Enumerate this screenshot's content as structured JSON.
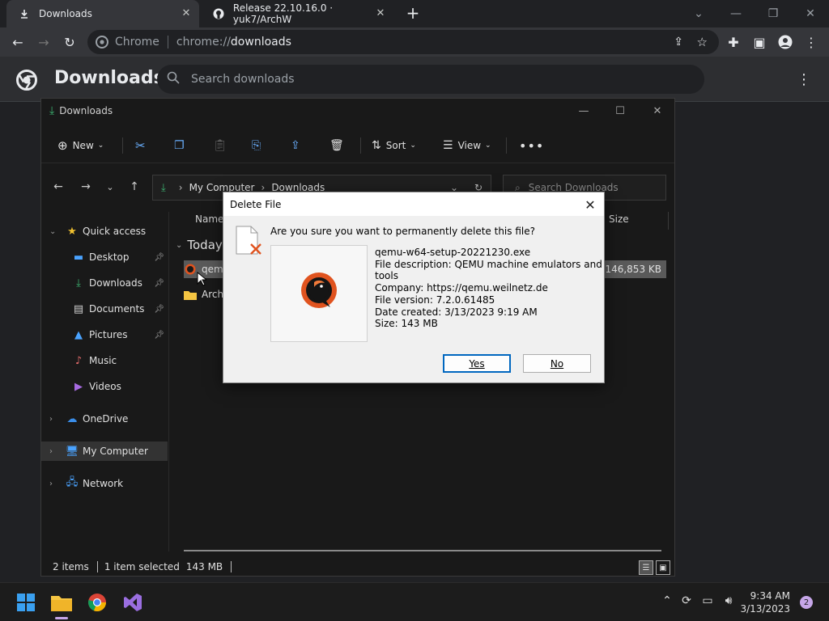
{
  "chrome": {
    "tabs": [
      {
        "title": "Downloads",
        "active": true
      },
      {
        "title": "Release 22.10.16.0 · yuk7/ArchW",
        "active": false
      }
    ],
    "omnibox": {
      "site_label": "Chrome",
      "scheme": "chrome://",
      "host": "downloads"
    }
  },
  "downloads_page": {
    "title": "Downloads",
    "search_placeholder": "Search downloads"
  },
  "explorer": {
    "title": "Downloads",
    "commands": {
      "new": "New",
      "sort": "Sort",
      "view": "View"
    },
    "breadcrumb": [
      "My Computer",
      "Downloads"
    ],
    "search_placeholder": "Search Downloads",
    "sidebar": {
      "quick_access": "Quick access",
      "items": [
        {
          "label": "Desktop"
        },
        {
          "label": "Downloads"
        },
        {
          "label": "Documents"
        },
        {
          "label": "Pictures"
        },
        {
          "label": "Music"
        },
        {
          "label": "Videos"
        }
      ],
      "onedrive": "OneDrive",
      "my_computer": "My Computer",
      "network": "Network"
    },
    "columns": {
      "name": "Name",
      "size": "Size"
    },
    "group": "Today",
    "files": [
      {
        "name": "qemu",
        "size": "146,853 KB",
        "selected": true
      },
      {
        "name": "Arch",
        "size": "",
        "selected": false
      }
    ],
    "status": {
      "items": "2 items",
      "selected": "1 item selected",
      "size": "143 MB"
    }
  },
  "dialog": {
    "title": "Delete File",
    "question": "Are you sure you want to permanently delete this file?",
    "filename": "qemu-w64-setup-20221230.exe",
    "description": "File description: QEMU machine emulators and tools",
    "company": "Company: https://qemu.weilnetz.de",
    "version": "File version: 7.2.0.61485",
    "created": "Date created: 3/13/2023 9:19 AM",
    "size": "Size: 143 MB",
    "yes": "Yes",
    "no": "No"
  },
  "taskbar": {
    "time": "9:34 AM",
    "date": "3/13/2023",
    "notification_count": "2"
  },
  "colors": {
    "chrome_bg": "#202124",
    "toolbar": "#35363a",
    "explorer_bg": "#191919",
    "accent_green": "#3cb371",
    "dialog_bg": "#f0f0f0",
    "default_button": "#0067c0"
  }
}
